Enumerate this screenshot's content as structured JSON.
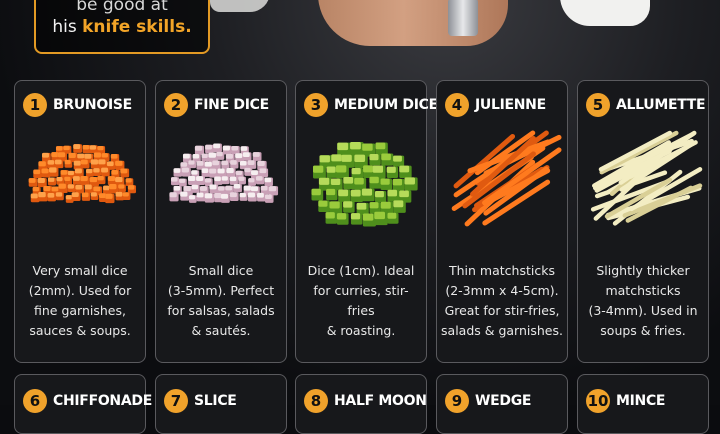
{
  "header": {
    "line1": "be good at",
    "line2_prefix": "his",
    "line2_highlight": "knife skills."
  },
  "colors": {
    "accent": "#f0a22b",
    "card_bg": "#17181b",
    "card_border": "#5a5a5e"
  },
  "cards": [
    {
      "num": "1",
      "name": "BRUNOISE",
      "desc": "Very small dice\n(2mm). Used for\nfine garnishes,\nsauces & soups.",
      "art": "orange-cubes"
    },
    {
      "num": "2",
      "name": "FINE DICE",
      "desc": "Small dice\n(3-5mm). Perfect\nfor salsas, salads\n& sautés.",
      "art": "onion-cubes"
    },
    {
      "num": "3",
      "name": "MEDIUM DICE",
      "desc": "Dice (1cm). Ideal\nfor curries, stir-fries\n& roasting.",
      "art": "green-cubes"
    },
    {
      "num": "4",
      "name": "JULIENNE",
      "desc": "Thin matchsticks\n(2-3mm x 4-5cm).\nGreat for stir-fries,\nsalads & garnishes.",
      "art": "carrot-sticks"
    },
    {
      "num": "5",
      "name": "ALLUMETTE",
      "desc": "Slightly thicker\nmatchsticks\n(3-4mm). Used in\nsoups & fries.",
      "art": "potato-sticks"
    }
  ],
  "bottom_cards": [
    {
      "num": "6",
      "name": "CHIFFONADE"
    },
    {
      "num": "7",
      "name": "SLICE"
    },
    {
      "num": "8",
      "name": "HALF MOON"
    },
    {
      "num": "9",
      "name": "WEDGE"
    },
    {
      "num": "10",
      "name": "MINCE"
    }
  ]
}
